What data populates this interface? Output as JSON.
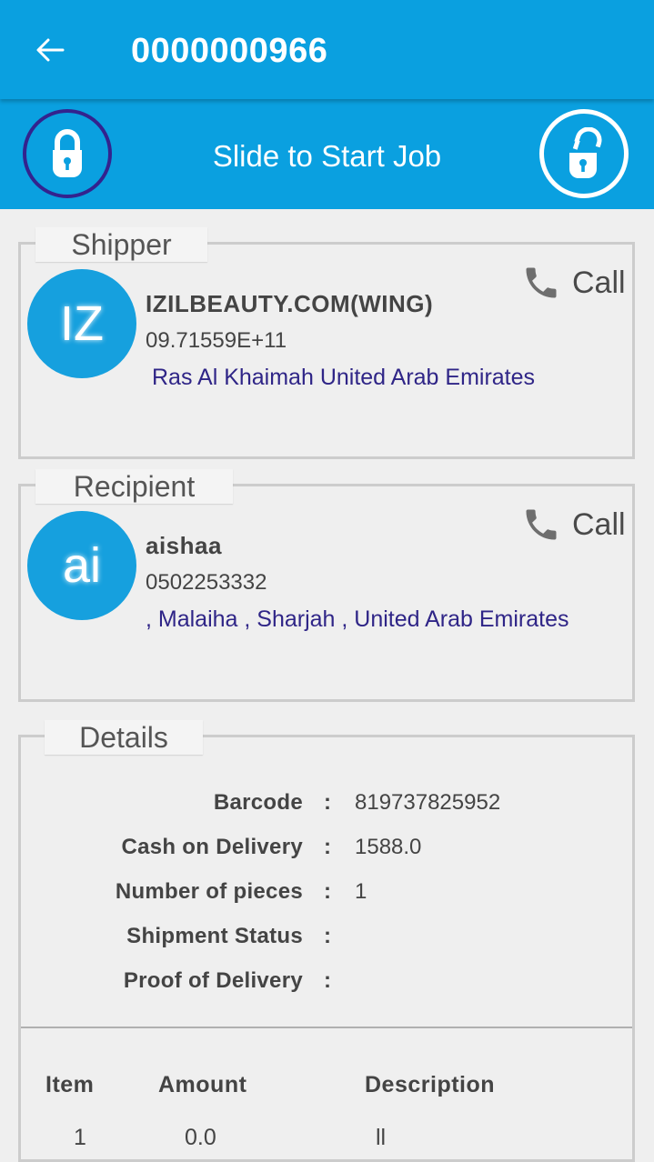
{
  "appbar": {
    "back_icon": "arrow-left-icon",
    "title": "0000000966"
  },
  "slider": {
    "label": "Slide to Start Job",
    "knob_icon": "lock-closed-icon",
    "target_icon": "lock-open-icon"
  },
  "shipper": {
    "section_label": "Shipper",
    "avatar_initials": "IZ",
    "name": "IZILBEAUTY.COM(WING)",
    "phone": "09.71559E+11",
    "address": "Ras Al Khaimah United Arab Emirates",
    "call_label": "Call"
  },
  "recipient": {
    "section_label": "Recipient",
    "avatar_initials": "ai",
    "name": "aishaa",
    "phone": "0502253332",
    "address": ", Malaiha , Sharjah , United Arab Emirates",
    "call_label": "Call"
  },
  "details": {
    "section_label": "Details",
    "colon": ":",
    "rows": [
      {
        "label": "Barcode",
        "value": "819737825952"
      },
      {
        "label": "Cash on Delivery",
        "value": "1588.0"
      },
      {
        "label": "Number of pieces",
        "value": "1"
      },
      {
        "label": "Shipment Status",
        "value": ""
      },
      {
        "label": "Proof of Delivery",
        "value": ""
      }
    ],
    "items_table": {
      "headers": [
        "Item",
        "Amount",
        "Description"
      ],
      "rows": [
        [
          "1",
          "0.0",
          "ll"
        ]
      ]
    }
  },
  "colors": {
    "primary": "#0aa0e0",
    "knob_border": "#33238e",
    "address_text": "#2f2587",
    "avatar_bg": "#16a0de"
  }
}
